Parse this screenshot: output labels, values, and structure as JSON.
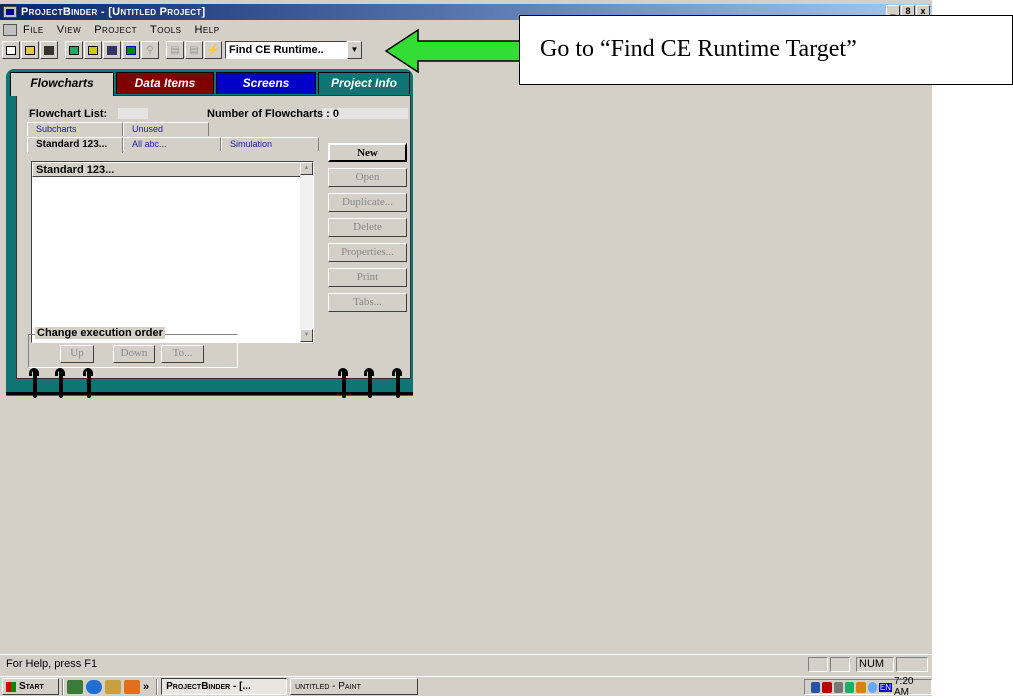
{
  "window": {
    "title": "ProjectBinder - [Untitled Project]",
    "minimize": "_",
    "restore": "8",
    "close": "x"
  },
  "menu": [
    "File",
    "View",
    "Project",
    "Tools",
    "Help"
  ],
  "toolbar": {
    "combo_value": "Find CE Runtime..",
    "combo_arrow": "▼"
  },
  "callout": {
    "text": "Go to “Find CE Runtime Target”"
  },
  "binder": {
    "tabs": [
      "Flowcharts",
      "Data Items",
      "Screens",
      "Project Info"
    ],
    "flowchart_list_label": "Flowchart List:",
    "count_label": "Number of Flowcharts : 0",
    "subtabs_row1": [
      "Subcharts",
      "Unused"
    ],
    "subtabs_row2": [
      "Standard 123...",
      "All abc...",
      "Simulation"
    ],
    "list_header": "Standard 123...",
    "buttons": [
      "New",
      "Open",
      "Duplicate...",
      "Delete",
      "Properties...",
      "Print",
      "Tabs..."
    ],
    "group_label": "Change execution order",
    "order_buttons": [
      "Up",
      "Down",
      "To..."
    ]
  },
  "status": {
    "help": "For Help, press F1",
    "num": "NUM"
  },
  "taskbar": {
    "start": "Start",
    "more": "»",
    "tasks": [
      "ProjectBinder - [...",
      "untitled - Paint"
    ],
    "lang": "EN",
    "clock": "7:20 AM"
  },
  "colors": {
    "binder": "#0e7474",
    "tab_data_items": "#800000",
    "tab_screens": "#0000c8",
    "arrow": "#33dd33"
  }
}
